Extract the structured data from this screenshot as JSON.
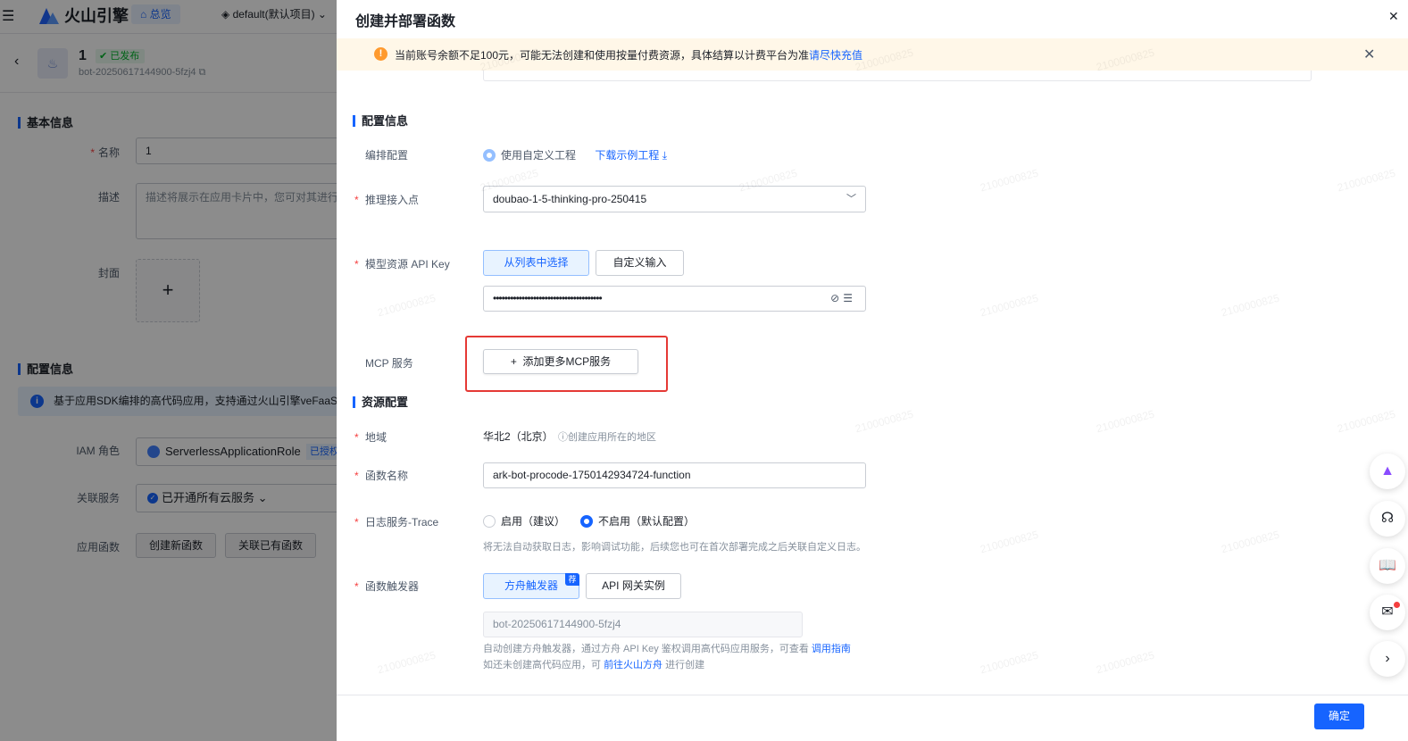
{
  "background": {
    "brand": "火山引擎",
    "overview_label": "总览",
    "project": "default(默认项目)",
    "app": {
      "name": "1",
      "status": "已发布",
      "id": "bot-20250617144900-5fzj4"
    },
    "section_basic": "基本信息",
    "name_label": "名称",
    "name_value": "1",
    "desc_label": "描述",
    "desc_placeholder": "描述将展示在应用卡片中，您可对其进行编辑",
    "cover_label": "封面",
    "section_config": "配置信息",
    "notice": "基于应用SDK编排的高代码应用，支持通过火山引擎veFaaS部署",
    "iam_label": "IAM 角色",
    "iam_value": "ServerlessApplicationRole",
    "iam_badge": "已授权",
    "related_label": "关联服务",
    "related_value": "已开通所有云服务",
    "func_label": "应用函数",
    "btn_create": "创建新函数",
    "btn_link": "关联已有函数"
  },
  "drawer": {
    "title": "创建并部署函数",
    "alert": {
      "text": "当前账号余额不足100元，可能无法创建和使用按量付费资源，具体结算以计费平台为准",
      "link": "请尽快充值"
    },
    "section_config": "配置信息",
    "orchestration": {
      "label": "编排配置",
      "option": "使用自定义工程",
      "download": "下载示例工程"
    },
    "endpoint": {
      "label": "推理接入点",
      "value": "doubao-1-5-thinking-pro-250415"
    },
    "api_key": {
      "label": "模型资源 API Key",
      "btn_list": "从列表中选择",
      "btn_custom": "自定义输入",
      "value": "••••••••••••••••••••••••••••••••••••••"
    },
    "mcp": {
      "label": "MCP 服务",
      "button": "添加更多MCP服务"
    },
    "section_resource": "资源配置",
    "region": {
      "label": "地域",
      "value": "华北2（北京）",
      "hint": "创建应用所在的地区"
    },
    "function_name": {
      "label": "函数名称",
      "value": "ark-bot-procode-1750142934724-function"
    },
    "log_trace": {
      "label": "日志服务-Trace",
      "option_on": "启用（建议）",
      "option_off": "不启用（默认配置）",
      "hint": "将无法自动获取日志，影响调试功能，后续您也可在首次部署完成之后关联自定义日志。"
    },
    "trigger": {
      "label": "函数触发器",
      "btn_ark": "方舟触发器",
      "rec_tag": "荐",
      "btn_api": "API 网关实例",
      "value": "bot-20250617144900-5fzj4",
      "hint1_prefix": "自动创建方舟触发器，通过方舟 API Key 鉴权调用高代码应用服务，可查看",
      "hint1_link": "调用指南",
      "hint2_prefix": "如还未创建高代码应用，可",
      "hint2_link": "前往火山方舟",
      "hint2_suffix": "进行创建"
    },
    "confirm": "确定"
  },
  "watermark": "2100000825",
  "icons": {
    "close": "close-icon",
    "warning": "warning-icon",
    "info": "info-icon",
    "download": "download-icon",
    "chevron": "chevron-down-icon",
    "eye_off": "eye-off-icon",
    "list": "list-icon",
    "plus": "plus-icon"
  },
  "colors": {
    "primary": "#1664ff",
    "warning_bg": "#fff7e8",
    "warning": "#ff9a2e",
    "required": "#f53f3f",
    "highlight": "#e53935",
    "success": "#00b42a"
  }
}
